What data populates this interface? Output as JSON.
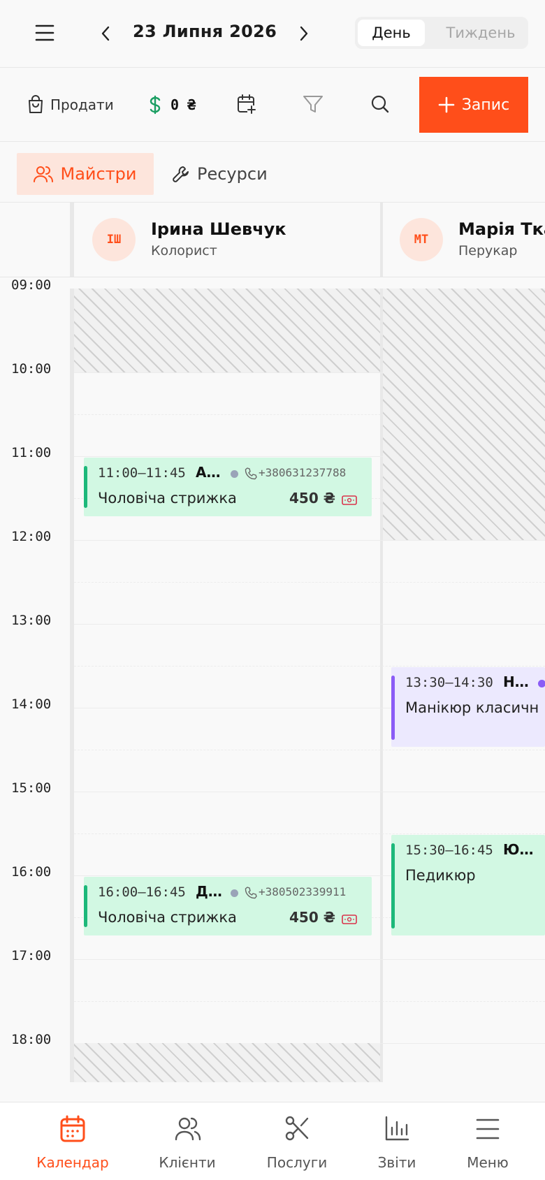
{
  "header": {
    "date": "23 Липня 2026",
    "view_day": "День",
    "view_week": "Тиждень"
  },
  "toolbar": {
    "sell_label": "Продати",
    "balance": "0 ₴",
    "add_label": "Запис"
  },
  "tabs": {
    "masters": "Майстри",
    "resources": "Ресурси"
  },
  "staff": [
    {
      "initials": "ІШ",
      "name": "Ірина Шевчук",
      "role": "Колорист"
    },
    {
      "initials": "МТ",
      "name": "Марія Тка",
      "role": "Перукар"
    }
  ],
  "hours": [
    "09:00",
    "10:00",
    "11:00",
    "12:00",
    "13:00",
    "14:00",
    "15:00",
    "16:00",
    "17:00",
    "18:00"
  ],
  "appointments": [
    {
      "time": "11:00–11:45",
      "client": "А…",
      "phone": "+380631237788",
      "service": "Чоловіча стрижка",
      "price": "450 ₴"
    },
    {
      "time": "16:00–16:45",
      "client": "Д…",
      "phone": "+380502339911",
      "service": "Чоловіча стрижка",
      "price": "450 ₴"
    },
    {
      "time": "13:30–14:30",
      "client": "Н…",
      "service": "Манікюр класичн"
    },
    {
      "time": "15:30–16:45",
      "client": "Ю…",
      "service": "Педикюр"
    }
  ],
  "colors": {
    "accent": "#ff4e1a",
    "green_event": "#d2f8e3",
    "green_bar": "#1db87a",
    "purple_event": "#ece9fe",
    "purple_bar": "#8b5cf6"
  },
  "nav": {
    "calendar": "Календар",
    "clients": "Клієнти",
    "services": "Послуги",
    "reports": "Звіти",
    "menu": "Меню"
  }
}
